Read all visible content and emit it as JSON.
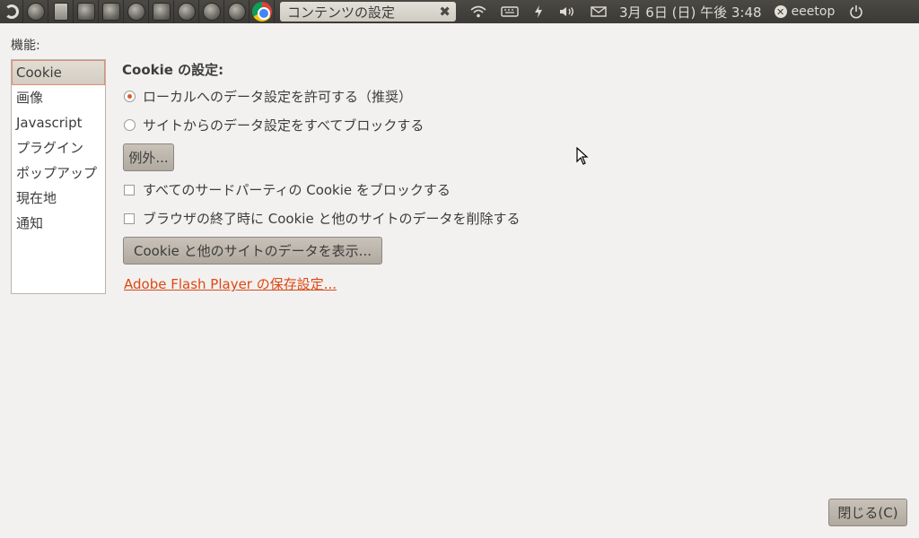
{
  "panel": {
    "window_title": "コンテンツの設定",
    "clock": "3月 6日 (日) 午後 3:48",
    "user": "eeetop"
  },
  "dialog": {
    "features_label": "機能:",
    "features": [
      "Cookie",
      "画像",
      "Javascript",
      "プラグイン",
      "ポップアップ",
      "現在地",
      "通知"
    ],
    "selected_feature": "Cookie",
    "section_title": "Cookie の設定:",
    "radio_allow": "ローカルへのデータ設定を許可する（推奨）",
    "radio_block": "サイトからのデータ設定をすべてブロックする",
    "exceptions_button": "例外...",
    "checkbox_third_party": "すべてのサードパーティの Cookie をブロックする",
    "checkbox_clear_on_exit": "ブラウザの終了時に Cookie と他のサイトのデータを削除する",
    "show_cookies_button": "Cookie と他のサイトのデータを表示...",
    "flash_link": "Adobe Flash Player の保存設定...",
    "close_button": "閉じる(C)"
  },
  "colors": {
    "accent": "#dd4814",
    "background": "#f2f1f0",
    "panel": "#3b3a36"
  }
}
